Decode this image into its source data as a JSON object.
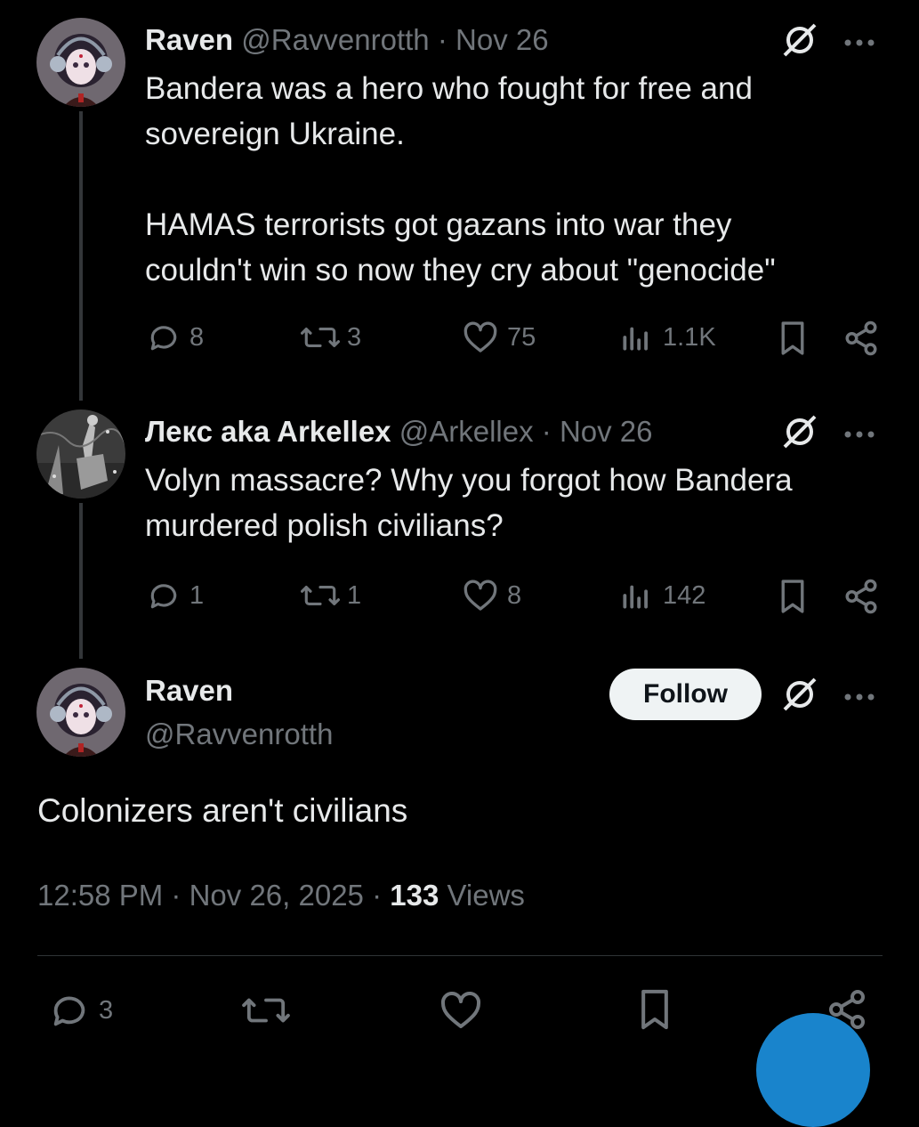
{
  "tweets": [
    {
      "name": "Raven",
      "handle": "@Ravvenrotth",
      "dot": "·",
      "date": "Nov 26",
      "text": "Bandera was a hero who fought for free and\nsovereign Ukraine.\n\nHAMAS terrorists got gazans into war they\ncouldn't win so now they cry about \"genocide\"",
      "replies": "8",
      "reposts": "3",
      "likes": "75",
      "views": "1.1K"
    },
    {
      "name": "Лекс aka Arkellex",
      "handle": "@Arkellex",
      "dot": "·",
      "date": "Nov 26",
      "text": "Volyn massacre? Why you forgot how Bandera\nmurdered polish civilians?",
      "replies": "1",
      "reposts": "1",
      "likes": "8",
      "views": "142"
    }
  ],
  "main": {
    "name": "Raven",
    "handle": "@Ravvenrotth",
    "follow_label": "Follow",
    "text": "Colonizers aren't civilians",
    "time": "12:58 PM",
    "dot1": "·",
    "date": "Nov 26, 2025",
    "dot2": "·",
    "views_count": "133",
    "views_label": "Views",
    "replies": "3"
  },
  "icons": {
    "more": "more-icon",
    "grok": "grok-icon",
    "reply": "reply-icon",
    "repost": "repost-icon",
    "like": "heart-icon",
    "views": "views-icon",
    "bookmark": "bookmark-icon",
    "share": "share-icon"
  },
  "colors": {
    "background": "#000000",
    "text": "#e7e9ea",
    "muted": "#71767b",
    "accent": "#1d9bf0"
  }
}
